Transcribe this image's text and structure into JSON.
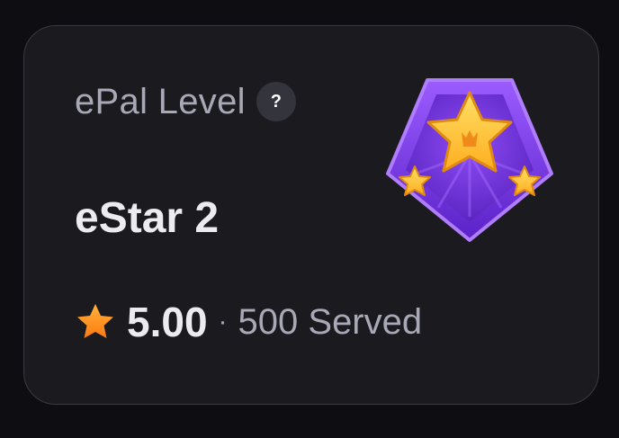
{
  "card": {
    "title": "ePal Level",
    "help_icon_text": "?",
    "level_name": "eStar 2",
    "badge_icon": "estar-badge-icon",
    "rating": "5.00",
    "separator": "·",
    "served": "500 Served",
    "rating_icon": "star-icon"
  },
  "colors": {
    "background": "#0e0e12",
    "card": "#1a1a1f",
    "card_border": "#3a3a42",
    "muted_text": "#a9a8b6",
    "primary_text": "#ececf0",
    "badge_purple": "#7b3fe4",
    "star_gold": "#ffc32b",
    "rating_orange": "#ff9a1f"
  }
}
